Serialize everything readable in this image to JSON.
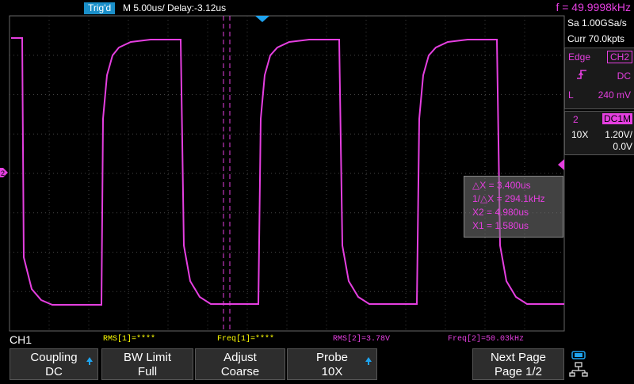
{
  "header": {
    "trigger_status": "Trig'd",
    "timebase": "M 5.00us/  Delay:-3.12us",
    "frequency": "f = 49.9998kHz"
  },
  "acquisition": {
    "sample_rate": "Sa 1.00GSa/s",
    "memory": "Curr 70.0kpts"
  },
  "trigger_panel": {
    "mode": "Edge",
    "source": "CH2",
    "slope_icon": "rising-edge-icon",
    "coupling": "DC",
    "level_label": "L",
    "level": "240 mV"
  },
  "channel_panel": {
    "number": "2",
    "coupling": "DC1M",
    "probe": "10X",
    "scale": "1.20V/",
    "offset": "0.0V"
  },
  "cursor_readout": {
    "delta_x": "△X = 3.400us",
    "inv_delta_x": "1/△X = 294.1kHz",
    "x2": "X2 = 4.980us",
    "x1": "X1 = 1.580us"
  },
  "measurements": {
    "channel_label": "CH1",
    "rms1": "RMS[1]=****",
    "freq1": "Freq[1]=****",
    "rms2": "RMS[2]=3.78V",
    "freq2": "Freq[2]=50.03kHz"
  },
  "softkeys": [
    {
      "line1": "Coupling",
      "line2": "DC"
    },
    {
      "line1": "BW Limit",
      "line2": "Full"
    },
    {
      "line1": "Adjust",
      "line2": "Coarse"
    },
    {
      "line1": "Probe",
      "line2": "10X"
    },
    {
      "line1": "Next Page",
      "line2": "Page 1/2"
    }
  ],
  "waveform": {
    "channel": "CH2",
    "color": "#e53fe0",
    "shape": "square wave",
    "frequency_khz": 50.03
  },
  "colors": {
    "ch2": "#e53fe0",
    "ch1": "#ffff00",
    "accent": "#1a8fc9",
    "grid": "#555555"
  },
  "icons": {
    "channel2_marker": "channel-2-marker-icon",
    "trigger_marker": "trigger-position-icon",
    "trigger_level_marker": "trigger-level-icon",
    "usb": "usb-icon",
    "network": "network-icon"
  }
}
